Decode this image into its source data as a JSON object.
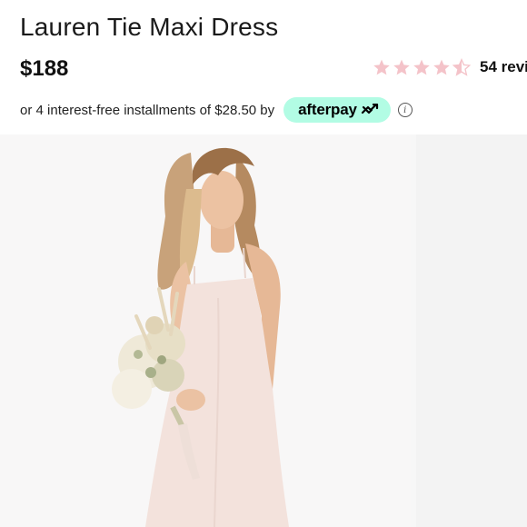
{
  "product": {
    "title": "Lauren Tie Maxi Dress",
    "price": "$188"
  },
  "rating": {
    "stars": 4.5,
    "max_stars": 5,
    "star_color": "#f4c3c9",
    "reviews_label": "54 revi"
  },
  "installments": {
    "text": "or 4 interest-free installments of $28.50 by",
    "provider": "afterpay",
    "badge_color": "#b2fce4",
    "info_icon": "info-icon"
  },
  "gallery": {
    "main_image": "product-photo-model-in-blush-maxi-dress-holding-bouquet",
    "next_image": "next-product-photo-partial"
  }
}
